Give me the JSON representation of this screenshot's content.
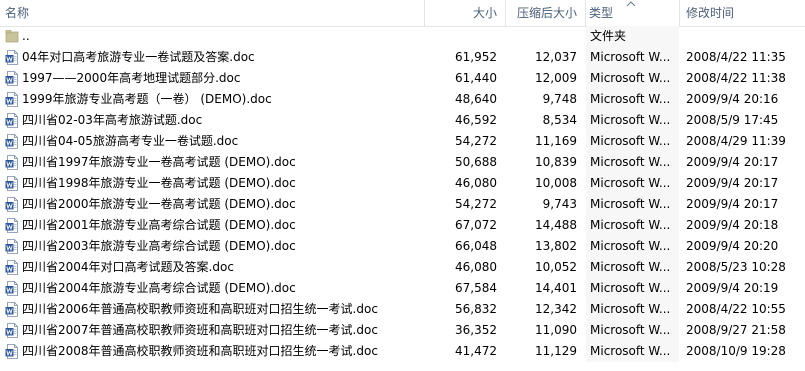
{
  "header": {
    "name": "名称",
    "size": "大小",
    "compressed": "压缩后大小",
    "type": "类型",
    "modified": "修改时间"
  },
  "rows": [
    {
      "name": "..",
      "size": "",
      "compressed": "",
      "type": "文件夹",
      "date": "",
      "icon": "folder-icon"
    },
    {
      "name": "04年对口高考旅游专业一卷试题及答案.doc",
      "size": "61,952",
      "compressed": "12,037",
      "type": "Microsoft W...",
      "date": "2008/4/22 11:35",
      "icon": "word-doc-icon"
    },
    {
      "name": "1997——2000年高考地理试题部分.doc",
      "size": "61,440",
      "compressed": "12,009",
      "type": "Microsoft W...",
      "date": "2008/4/22 11:38",
      "icon": "word-doc-icon"
    },
    {
      "name": "1999年旅游专业高考题（一卷） (DEMO).doc",
      "size": "48,640",
      "compressed": "9,748",
      "type": "Microsoft W...",
      "date": "2009/9/4 20:16",
      "icon": "word-doc-icon"
    },
    {
      "name": "四川省02-03年高考旅游试题.doc",
      "size": "46,592",
      "compressed": "8,534",
      "type": "Microsoft W...",
      "date": "2008/5/9 17:45",
      "icon": "word-doc-icon"
    },
    {
      "name": "四川省04-05旅游高考专业一卷试题.doc",
      "size": "54,272",
      "compressed": "11,169",
      "type": "Microsoft W...",
      "date": "2008/4/29 11:39",
      "icon": "word-doc-icon"
    },
    {
      "name": "四川省1997年旅游专业一卷高考试题 (DEMO).doc",
      "size": "50,688",
      "compressed": "10,839",
      "type": "Microsoft W...",
      "date": "2009/9/4 20:17",
      "icon": "word-doc-icon"
    },
    {
      "name": "四川省1998年旅游专业一卷高考试题 (DEMO).doc",
      "size": "46,080",
      "compressed": "10,008",
      "type": "Microsoft W...",
      "date": "2009/9/4 20:17",
      "icon": "word-doc-icon"
    },
    {
      "name": "四川省2000年旅游专业一卷高考试题 (DEMO).doc",
      "size": "54,272",
      "compressed": "9,743",
      "type": "Microsoft W...",
      "date": "2009/9/4 20:17",
      "icon": "word-doc-icon"
    },
    {
      "name": "四川省2001年旅游专业高考综合试题 (DEMO).doc",
      "size": "67,072",
      "compressed": "14,488",
      "type": "Microsoft W...",
      "date": "2009/9/4 20:18",
      "icon": "word-doc-icon"
    },
    {
      "name": "四川省2003年旅游专业高考综合试题 (DEMO).doc",
      "size": "66,048",
      "compressed": "13,802",
      "type": "Microsoft W...",
      "date": "2009/9/4 20:20",
      "icon": "word-doc-icon"
    },
    {
      "name": "四川省2004年对口高考试题及答案.doc",
      "size": "46,080",
      "compressed": "10,052",
      "type": "Microsoft W...",
      "date": "2008/5/23 10:28",
      "icon": "word-doc-icon"
    },
    {
      "name": "四川省2004年旅游专业高考综合试题 (DEMO).doc",
      "size": "67,584",
      "compressed": "14,401",
      "type": "Microsoft W...",
      "date": "2009/9/4 20:19",
      "icon": "word-doc-icon"
    },
    {
      "name": "四川省2006年普通高校职教师资班和高职班对口招生统一考试.doc",
      "size": "56,832",
      "compressed": "12,342",
      "type": "Microsoft W...",
      "date": "2008/4/22 10:55",
      "icon": "word-doc-icon"
    },
    {
      "name": "四川省2007年普通高校职教师资班和高职班对口招生统一考试.doc",
      "size": "36,352",
      "compressed": "11,090",
      "type": "Microsoft W...",
      "date": "2008/9/27 21:58",
      "icon": "word-doc-icon"
    },
    {
      "name": "四川省2008年普通高校职教师资班和高职班对口招生统一考试.doc",
      "size": "41,472",
      "compressed": "11,129",
      "type": "Microsoft W...",
      "date": "2008/10/9 19:28",
      "icon": "word-doc-icon"
    }
  ],
  "colors": {
    "header_text": "#4c607a",
    "sorted_column_bg": "#f7f7f7",
    "word_icon_blue": "#2b5797",
    "folder_icon": "#c9c39a"
  }
}
